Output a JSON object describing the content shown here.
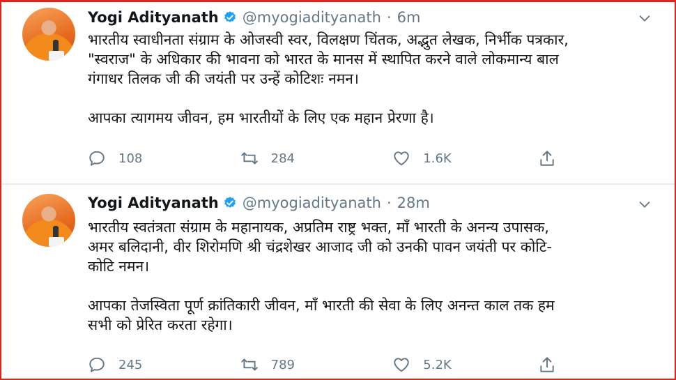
{
  "tweets": [
    {
      "author": {
        "name": "Yogi Adityanath",
        "handle": "@myogiadityanath"
      },
      "time": "6m",
      "separator": "·",
      "text": "भारतीय स्वाधीनता संग्राम के ओजस्वी स्वर, विलक्षण चिंतक, अद्भुत लेखक, निर्भीक पत्रकार,\n\"स्वराज\" के अधिकार की भावना को भारत के मानस में स्थापित करने वाले लोकमान्य बाल\nगंगाधर तिलक जी की जयंती पर उन्हें कोटिशः नमन।\n\nआपका त्यागमय जीवन, हम भारतीयों के लिए एक महान प्रेरणा है।",
      "stats": {
        "replies": "108",
        "retweets": "284",
        "likes": "1.6K"
      }
    },
    {
      "author": {
        "name": "Yogi Adityanath",
        "handle": "@myogiadityanath"
      },
      "time": "28m",
      "separator": "·",
      "text": "भारतीय स्वतंत्रता संग्राम के महानायक, अप्रतिम राष्ट्र भक्त, माँ भारती के अनन्य उपासक,\nअमर बलिदानी, वीर शिरोमणि श्री चंद्रशेखर आजाद जी को उनकी पावन जयंती पर कोटि-\nकोटि नमन।\n\nआपका तेजस्विता पूर्ण क्रांतिकारी जीवन, माँ भारती की सेवा के लिए अनन्त काल तक हम\nसभी को प्रेरित करता रहेगा।",
      "stats": {
        "replies": "245",
        "retweets": "789",
        "likes": "5.2K"
      }
    }
  ],
  "icons": {
    "verified": "verified-badge-icon",
    "reply": "reply-icon",
    "retweet": "retweet-icon",
    "like": "heart-icon",
    "share": "share-icon",
    "caret": "chevron-down-icon"
  },
  "colors": {
    "verified": "#1da1f2",
    "muted": "#657786",
    "border": "#e0241b",
    "divider": "#e6ecf0"
  }
}
